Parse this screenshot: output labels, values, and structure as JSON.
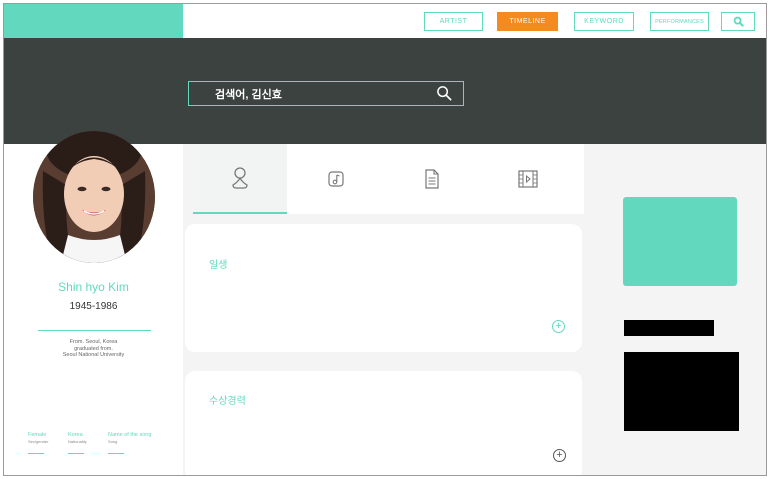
{
  "nav": {
    "items": [
      {
        "label": "ARTIST",
        "active": false
      },
      {
        "label": "TIMELINE",
        "active": true
      },
      {
        "label": "KEYWORD",
        "active": false
      },
      {
        "label": "PERFORMANCES",
        "active": false
      }
    ],
    "search_icon": "search-icon"
  },
  "search": {
    "value": "검색어, 김신효",
    "icon": "search-icon"
  },
  "profile": {
    "name": "Shin hyo Kim",
    "years": "1945-1986",
    "bio_line1": "From. Seoul, Korea",
    "bio_line2": "graduated from.",
    "bio_line3": "Seoul National University",
    "meta": [
      {
        "title": "Female",
        "sub": "Sex/gender"
      },
      {
        "title": "Korea",
        "sub": "Nationality"
      },
      {
        "title": "Name of the song",
        "sub": "Song"
      }
    ]
  },
  "tabs": [
    {
      "icon": "person-icon",
      "active": true
    },
    {
      "icon": "music-icon",
      "active": false
    },
    {
      "icon": "document-icon",
      "active": false
    },
    {
      "icon": "film-icon",
      "active": false
    }
  ],
  "cards": [
    {
      "title": "일생",
      "action_icon": "plus-circle-icon"
    },
    {
      "title": "수상경력",
      "action_icon": "plus-circle-icon"
    }
  ],
  "colors": {
    "accent": "#62d9bf",
    "active_nav": "#f58a1f",
    "hero": "#3c4240"
  }
}
